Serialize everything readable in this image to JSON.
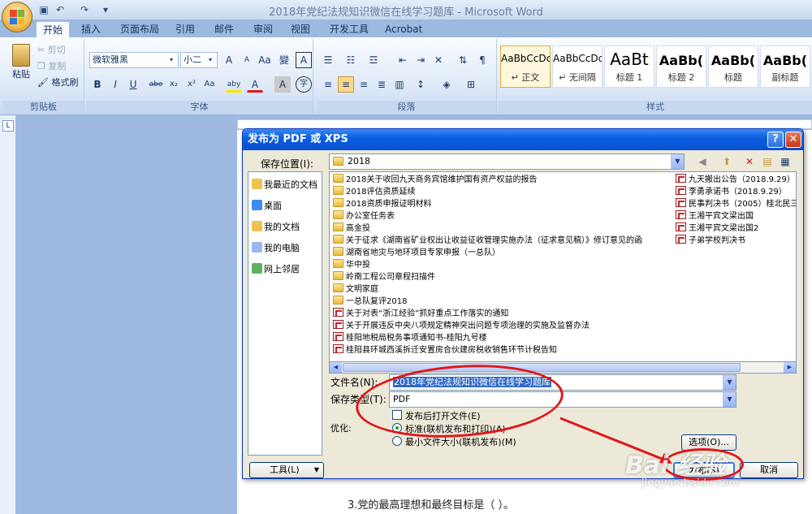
{
  "app": {
    "title": "2018年党纪法规知识微信在线学习题库 - Microsoft Word",
    "tabs": [
      "开始",
      "插入",
      "页面布局",
      "引用",
      "邮件",
      "审阅",
      "视图",
      "开发工具",
      "Acrobat"
    ]
  },
  "ribbon": {
    "clipboard": {
      "paste": "粘贴",
      "cut": "剪切",
      "copy": "复制",
      "format_painter": "格式刷",
      "label": "剪贴板"
    },
    "font": {
      "name": "微软雅黑",
      "size": "小二",
      "label": "字体",
      "icons": [
        "A",
        "A",
        "Aa",
        "變",
        "A",
        "B",
        "I",
        "U",
        "abe",
        "x₂",
        "x²",
        "Aa",
        "aby",
        "A",
        "A",
        "字"
      ]
    },
    "paragraph": {
      "label": "段落"
    },
    "styles": {
      "label": "样式",
      "items": [
        {
          "sample": "AaBbCcDc",
          "name": "↵ 正文"
        },
        {
          "sample": "AaBbCcDc",
          "name": "↵ 无间隔"
        },
        {
          "sample": "AaBt",
          "name": "标题 1"
        },
        {
          "sample": "AaBb(",
          "name": "标题 2"
        },
        {
          "sample": "AaBb(",
          "name": "标题"
        },
        {
          "sample": "AaBb(",
          "name": "副标题"
        }
      ]
    }
  },
  "ruler_button": "L",
  "document": {
    "line": "3.党的最高理想和最终目标是（        ）。"
  },
  "dialog": {
    "title": "发布为 PDF 或 XPS",
    "save_in_label": "保存位置(I):",
    "save_in_value": "2018",
    "places": [
      "我最近的文档",
      "桌面",
      "我的文档",
      "我的电脑",
      "网上邻居"
    ],
    "files_left": [
      {
        "type": "folder",
        "name": "2018关于收回九天商务宾馆维护国有资产权益的报告"
      },
      {
        "type": "folder",
        "name": "2018评估资质延续"
      },
      {
        "type": "folder",
        "name": "2018资质申报证明材料"
      },
      {
        "type": "folder",
        "name": "办公室任务表"
      },
      {
        "type": "folder",
        "name": "高金投"
      },
      {
        "type": "folder",
        "name": "关于征求《湖南省矿业权出让收益征收管理实施办法（征求意见稿）》修订意见的函"
      },
      {
        "type": "folder",
        "name": "湖南省地灾与地环项目专家申报（一总队）"
      },
      {
        "type": "folder",
        "name": "华中投"
      },
      {
        "type": "folder",
        "name": "岭南工程公司章程扫描件"
      },
      {
        "type": "folder",
        "name": "文明家庭"
      },
      {
        "type": "folder",
        "name": "一总队复评2018"
      },
      {
        "type": "pdf",
        "name": "关于对表“浙江经验”抓好重点工作落实的通知"
      },
      {
        "type": "pdf",
        "name": "关于开展违反中央八项规定精神突出问题专项治理的实施及监督办法"
      },
      {
        "type": "pdf",
        "name": "桂阳地税局税务事项通知书-桂阳九号楼"
      },
      {
        "type": "pdf",
        "name": "桂阳县环城西溪拆迁安置房合伙建房税收销售环节计税告知"
      }
    ],
    "files_right": [
      {
        "type": "pdf",
        "name": "九天搬出公告（2018.9.29）"
      },
      {
        "type": "pdf",
        "name": "李勇承诺书（2018.9.29）"
      },
      {
        "type": "pdf",
        "name": "民事判决书（2005）桂北民三"
      },
      {
        "type": "pdf",
        "name": "王湘平宾文梁出国"
      },
      {
        "type": "pdf",
        "name": "王湘平宾文梁出国2"
      },
      {
        "type": "pdf",
        "name": "子弟学校判决书"
      }
    ],
    "filename_label": "文件名(N):",
    "filename_value": "2018年党纪法规知识微信在线学习题库",
    "savetype_label": "保存类型(T):",
    "savetype_value": "PDF",
    "open_after_label": "发布后打开文件(E)",
    "optimize_label": "优化:",
    "opt_standard": "标准(联机发布和打印)(A)",
    "opt_minimum": "最小文件大小(联机发布)(M)",
    "options_button": "选项(O)...",
    "tools_button": "工具(L)",
    "publish_button": "发布(S)",
    "cancel_button": "取消"
  },
  "watermark": {
    "brand": "Bai 经验",
    "url": "jingyan.baidu.com"
  }
}
